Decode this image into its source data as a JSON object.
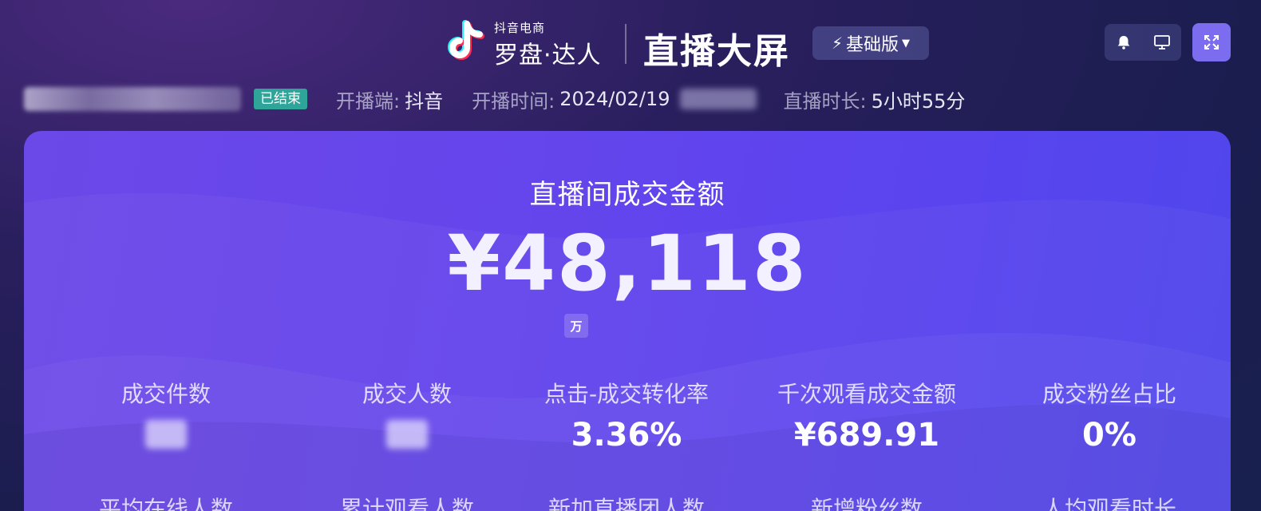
{
  "header": {
    "logo": {
      "sub_label": "抖音电商",
      "main_label": "罗盘·达人",
      "icon": "tiktok-note-icon"
    },
    "page_title": "直播大屏",
    "edition": {
      "label": "基础版",
      "icon": "bolt-icon",
      "dropdown_icon": "caret-down-icon"
    },
    "tools": {
      "notification_icon": "bell-icon",
      "display_icon": "monitor-icon",
      "fullscreen_icon": "expand-icon"
    }
  },
  "session": {
    "status": "已结束",
    "platform_label": "开播端:",
    "platform_value": "抖音",
    "start_label": "开播时间:",
    "start_value": "2024/02/19",
    "duration_label": "直播时长:",
    "duration_value": "5小时55分"
  },
  "hero": {
    "label": "直播间成交金额",
    "value": "¥48,118",
    "unit_toggle": "万"
  },
  "metrics_row1": [
    {
      "label": "成交件数",
      "value": ""
    },
    {
      "label": "成交人数",
      "value": ""
    },
    {
      "label": "点击-成交转化率",
      "value": "3.36%"
    },
    {
      "label": "千次观看成交金额",
      "value": "¥689.91"
    },
    {
      "label": "成交粉丝占比",
      "value": "0%"
    }
  ],
  "metrics_row2": [
    {
      "label": "平均在线人数"
    },
    {
      "label": "累计观看人数"
    },
    {
      "label": "新加直播团人数"
    },
    {
      "label": "新增粉丝数"
    },
    {
      "label": "人均观看时长"
    }
  ],
  "colors": {
    "panel_primary": "#6545ec",
    "status_badge": "#2fa59a",
    "fullscreen_button": "#7b6cf0"
  }
}
